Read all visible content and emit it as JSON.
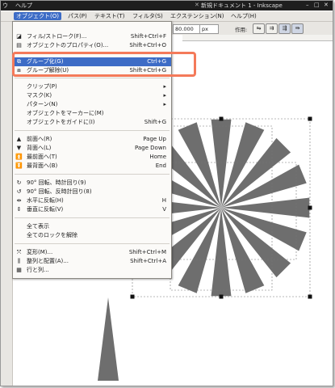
{
  "window": {
    "title": "新規ドキュメント 1 - Inkscape",
    "left_fragments": [
      "ウ",
      "ヘルプ"
    ]
  },
  "menubar": {
    "items": [
      "オブジェクト(O)",
      "パス(P)",
      "テキスト(T)",
      "フィルタ(S)",
      "エクステンション(N)",
      "ヘルプ(H)"
    ],
    "active_index": 0
  },
  "toolbar": {
    "zoom_value": "80.000",
    "unit": "px",
    "action_label": "作用:"
  },
  "object_menu": {
    "items": [
      {
        "label": "フィル/ストローク(F)...",
        "shortcut": "Shift+Ctrl+F",
        "icon": "fill-stroke-icon"
      },
      {
        "label": "オブジェクトのプロパティ(O)...",
        "shortcut": "Shift+Ctrl+O",
        "icon": "properties-icon"
      },
      {
        "label": "グループ化(G)",
        "shortcut": "Ctrl+G",
        "icon": "group-icon",
        "highlighted": true
      },
      {
        "label": "グループ解除(U)",
        "shortcut": "Shift+Ctrl+G",
        "icon": "ungroup-icon"
      },
      {
        "label": "クリップ(P)",
        "shortcut": "▸",
        "icon": ""
      },
      {
        "label": "マスク(K)",
        "shortcut": "▸",
        "icon": ""
      },
      {
        "label": "パターン(N)",
        "shortcut": "▸",
        "icon": ""
      },
      {
        "label": "オブジェクトをマーカーに(M)",
        "shortcut": "",
        "icon": ""
      },
      {
        "label": "オブジェクトをガイドに(I)",
        "shortcut": "Shift+G",
        "icon": ""
      },
      {
        "label": "前面へ(R)",
        "shortcut": "Page Up",
        "icon": "raise-icon"
      },
      {
        "label": "背面へ(L)",
        "shortcut": "Page Down",
        "icon": "lower-icon"
      },
      {
        "label": "最前面へ(T)",
        "shortcut": "Home",
        "icon": "raise-top-icon"
      },
      {
        "label": "最背面へ(B)",
        "shortcut": "End",
        "icon": "lower-bottom-icon"
      },
      {
        "label": "90° 回転、時計回り(9)",
        "shortcut": "",
        "icon": "rotate-cw-icon"
      },
      {
        "label": "90° 回転、反時計回り(8)",
        "shortcut": "",
        "icon": "rotate-ccw-icon"
      },
      {
        "label": "水平に反転(H)",
        "shortcut": "H",
        "icon": "flip-horizontal-icon"
      },
      {
        "label": "垂直に反転(V)",
        "shortcut": "V",
        "icon": "flip-vertical-icon"
      },
      {
        "label": "全て表示",
        "shortcut": "",
        "icon": ""
      },
      {
        "label": "全てのロックを解除",
        "shortcut": "",
        "icon": ""
      },
      {
        "label": "変形(M)...",
        "shortcut": "Shift+Ctrl+M",
        "icon": "transform-icon"
      },
      {
        "label": "整列と配置(A)...",
        "shortcut": "Shift+Ctrl+A",
        "icon": "align-icon"
      },
      {
        "label": "行と列...",
        "shortcut": "",
        "icon": "rows-columns-icon"
      }
    ]
  },
  "colors": {
    "menu_highlight": "#3d6cc6",
    "annotation_box": "#f47a5a",
    "shape_fill": "#6e6e6e"
  }
}
